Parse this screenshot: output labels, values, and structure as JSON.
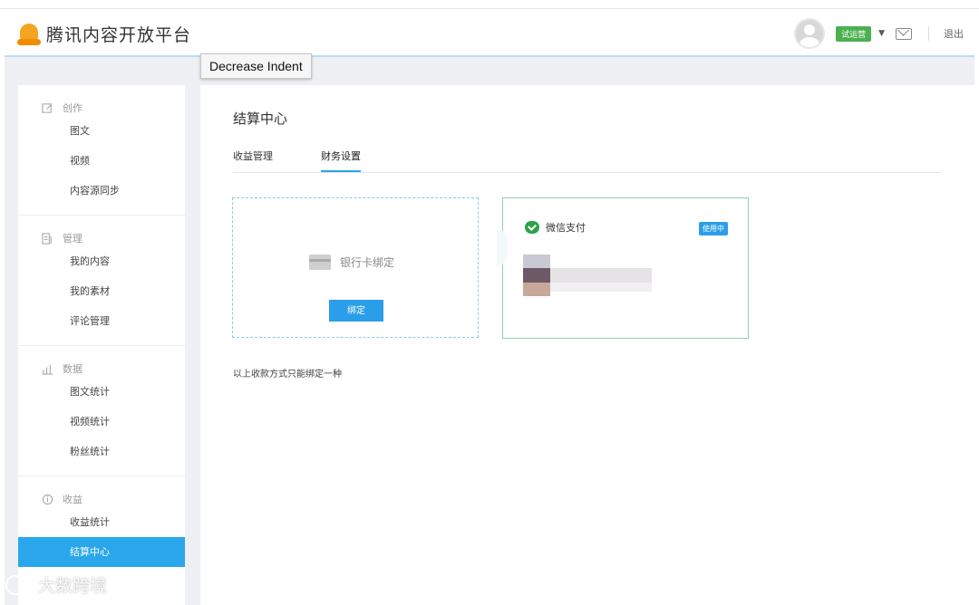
{
  "header": {
    "logo_text": "腾讯内容开放平台",
    "badge": "试运营",
    "logout": "退出"
  },
  "tooltip": "Decrease Indent",
  "sidebar": {
    "sections": [
      {
        "title": "创作",
        "items": [
          "图文",
          "视频",
          "内容源同步"
        ]
      },
      {
        "title": "管理",
        "items": [
          "我的内容",
          "我的素材",
          "评论管理"
        ]
      },
      {
        "title": "数据",
        "items": [
          "图文统计",
          "视频统计",
          "粉丝统计"
        ]
      },
      {
        "title": "收益",
        "items": [
          "收益统计",
          "结算中心"
        ]
      }
    ]
  },
  "main": {
    "title": "结算中心",
    "tabs": [
      "收益管理",
      "财务设置"
    ],
    "active_tab": "财务设置",
    "bank_card": {
      "label": "银行卡绑定",
      "button": "绑定"
    },
    "wechat_card": {
      "label": "微信支付",
      "status": "使用中"
    },
    "note": "以上收款方式只能绑定一种"
  },
  "watermark": "大数跨境",
  "colors": {
    "accent": "#2aa7ea",
    "wechat_green": "#2ba346",
    "badge_green": "#4caf50"
  }
}
